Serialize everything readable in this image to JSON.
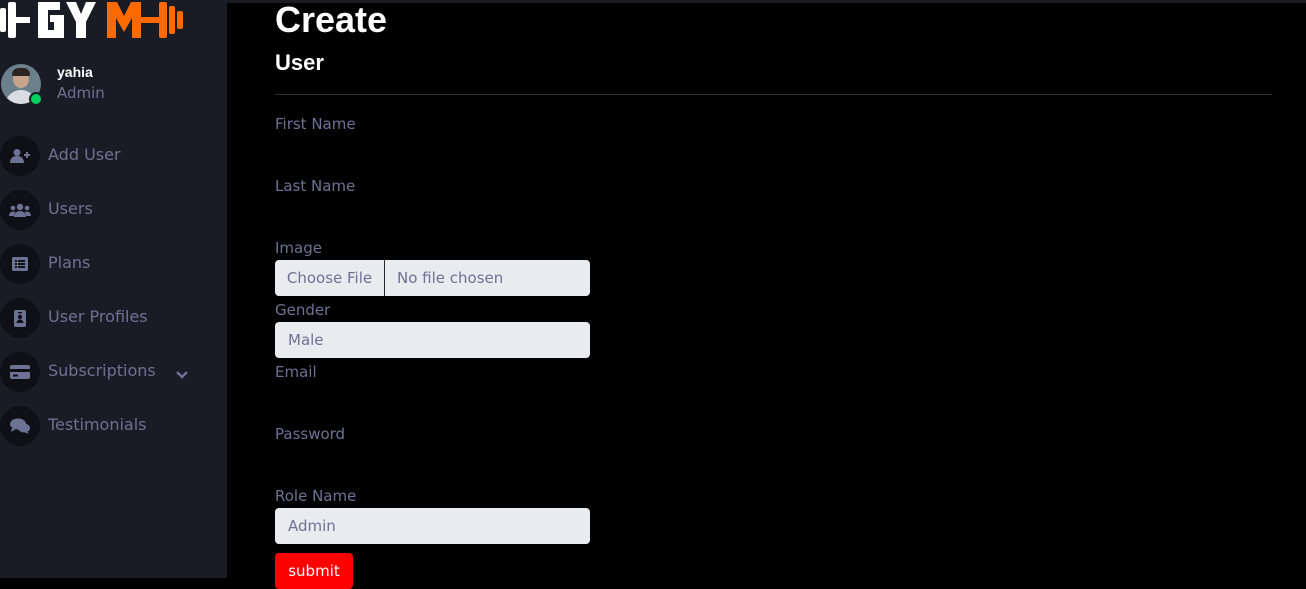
{
  "brand": {
    "logo_text": "GYM",
    "accent_color": "#ff6a00"
  },
  "profile": {
    "name": "yahia",
    "role": "Admin",
    "status_color": "#00d25b"
  },
  "sidebar": {
    "items": [
      {
        "label": "Add User",
        "icon": "user-plus-icon"
      },
      {
        "label": "Users",
        "icon": "users-icon"
      },
      {
        "label": "Plans",
        "icon": "list-icon"
      },
      {
        "label": "User Profiles",
        "icon": "id-badge-icon"
      },
      {
        "label": "Subscriptions",
        "icon": "credit-card-icon",
        "has_submenu": true
      },
      {
        "label": "Testimonials",
        "icon": "comments-icon"
      }
    ]
  },
  "main": {
    "title": "Create",
    "card_title": "User",
    "form": {
      "first_name_label": "First Name",
      "last_name_label": "Last Name",
      "image_label": "Image",
      "file_button": "Choose File",
      "file_status": "No file chosen",
      "gender_label": "Gender",
      "gender_value": "Male",
      "email_label": "Email",
      "password_label": "Password",
      "role_label": "Role Name",
      "role_value": "Admin",
      "submit_label": "submit"
    }
  },
  "colors": {
    "sidebar_bg": "#191c24",
    "main_bg": "#000000",
    "muted_text": "#6c7293",
    "input_bg": "#e9ecef",
    "submit_bg": "#ff0000"
  }
}
